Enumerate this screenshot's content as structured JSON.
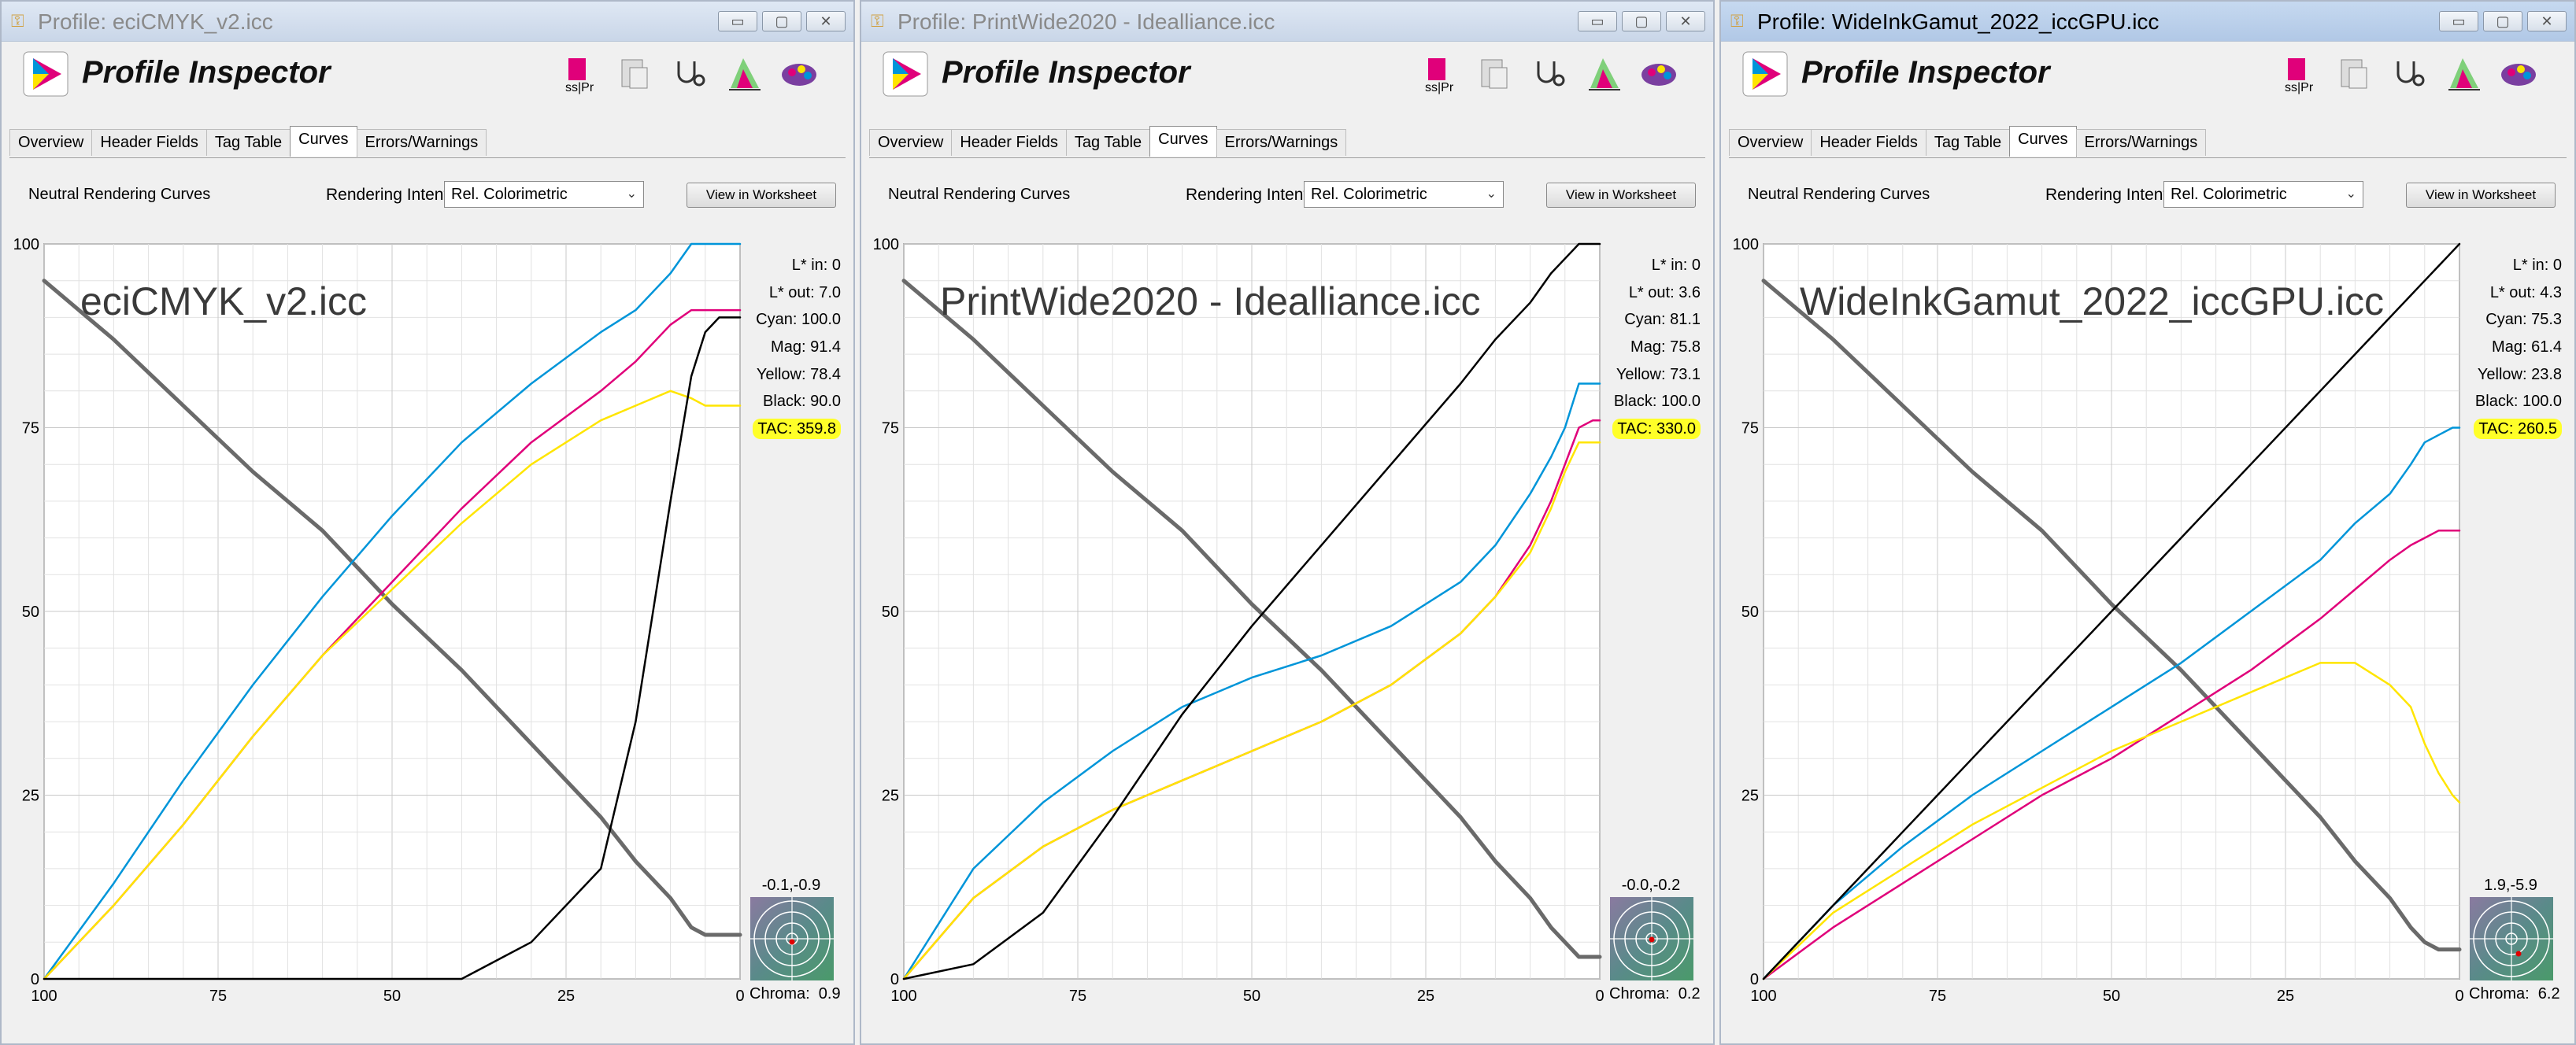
{
  "app_title": "Profile Inspector",
  "tabs": [
    "Overview",
    "Header Fields",
    "Tag Table",
    "Curves",
    "Errors/Warnings"
  ],
  "selected_tab": "Curves",
  "neutral_label": "Neutral Rendering Curves",
  "rendering_intent_label": "Rendering Intent:",
  "rendering_intent_value": "Rel. Colorimetric",
  "view_button": "View in Worksheet",
  "toolbar_icons": [
    "profile-compare-icon",
    "document-icon",
    "stethoscope-icon",
    "gamut-icon",
    "palette-icon"
  ],
  "colors": {
    "cyan": "#0095d9",
    "magenta": "#e0007a",
    "yellow": "#ffe500",
    "black": "#000000",
    "gray": "#6a6a6a",
    "tac_highlight": "#ffff28"
  },
  "axis": {
    "y_ticks": [
      "100",
      "75",
      "50",
      "25",
      "0"
    ],
    "x_ticks": [
      "100",
      "75",
      "50",
      "25",
      "0"
    ]
  },
  "windows": [
    {
      "title": "Profile: eciCMYK_v2.icc",
      "chart_label": "eciCMYK_v2.icc",
      "readout": {
        "l_in": "L* in: 0",
        "l_out": "L* out: 7.0",
        "cyan": "Cyan: 100.0",
        "mag": "Mag: 91.4",
        "yellow": "Yellow: 78.4",
        "black": "Black: 90.0",
        "tac": "TAC: 359.8"
      },
      "bullseye_label": "-0.1,-0.9",
      "chroma": "Chroma:  0.9"
    },
    {
      "title": "Profile: PrintWide2020 - Idealliance.icc",
      "chart_label": "PrintWide2020 - Idealliance.icc",
      "readout": {
        "l_in": "L* in: 0",
        "l_out": "L* out: 3.6",
        "cyan": "Cyan: 81.1",
        "mag": "Mag: 75.8",
        "yellow": "Yellow: 73.1",
        "black": "Black: 100.0",
        "tac": "TAC: 330.0"
      },
      "bullseye_label": "-0.0,-0.2",
      "chroma": "Chroma:  0.2"
    },
    {
      "title": "Profile: WideInkGamut_2022_iccGPU.icc",
      "chart_label": "WideInkGamut_2022_iccGPU.icc",
      "readout": {
        "l_in": "L* in: 0",
        "l_out": "L* out: 4.3",
        "cyan": "Cyan: 75.3",
        "mag": "Mag: 61.4",
        "yellow": "Yellow: 23.8",
        "black": "Black: 100.0",
        "tac": "TAC: 260.5"
      },
      "bullseye_label": "1.9,-5.9",
      "chroma": "Chroma:  6.2"
    }
  ],
  "chart_data": [
    {
      "type": "line",
      "title": "eciCMYK_v2.icc",
      "xlim": [
        100,
        0
      ],
      "ylim": [
        0,
        100
      ],
      "x": [
        100,
        90,
        80,
        70,
        60,
        50,
        40,
        30,
        20,
        15,
        10,
        7,
        5,
        3,
        1,
        0
      ],
      "series": [
        {
          "name": "gray",
          "values": [
            95,
            87,
            78,
            69,
            61,
            51,
            42,
            32,
            22,
            16,
            11,
            7,
            6,
            6,
            6,
            6
          ]
        },
        {
          "name": "cyan",
          "values": [
            0,
            13,
            27,
            40,
            52,
            63,
            73,
            81,
            88,
            91,
            96,
            100,
            100,
            100,
            100,
            100
          ]
        },
        {
          "name": "magenta",
          "values": [
            0,
            10,
            21,
            33,
            44,
            54,
            64,
            73,
            80,
            84,
            89,
            91,
            91,
            91,
            91,
            91
          ]
        },
        {
          "name": "yellow",
          "values": [
            0,
            10,
            21,
            33,
            44,
            53,
            62,
            70,
            76,
            78,
            80,
            79,
            78,
            78,
            78,
            78
          ]
        },
        {
          "name": "black",
          "values": [
            0,
            0,
            0,
            0,
            0,
            0,
            0,
            5,
            15,
            35,
            65,
            82,
            88,
            90,
            90,
            90
          ]
        }
      ]
    },
    {
      "type": "line",
      "title": "PrintWide2020 - Idealliance.icc",
      "xlim": [
        100,
        0
      ],
      "ylim": [
        0,
        100
      ],
      "x": [
        100,
        90,
        80,
        70,
        60,
        50,
        40,
        30,
        20,
        15,
        10,
        7,
        5,
        3,
        1,
        0
      ],
      "series": [
        {
          "name": "gray",
          "values": [
            95,
            87,
            78,
            69,
            61,
            51,
            42,
            32,
            22,
            16,
            11,
            7,
            5,
            3,
            3,
            3
          ]
        },
        {
          "name": "cyan",
          "values": [
            0,
            15,
            24,
            31,
            37,
            41,
            44,
            48,
            54,
            59,
            66,
            71,
            75,
            81,
            81,
            81
          ]
        },
        {
          "name": "magenta",
          "values": [
            0,
            11,
            18,
            23,
            27,
            31,
            35,
            40,
            47,
            52,
            59,
            65,
            70,
            75,
            76,
            76
          ]
        },
        {
          "name": "yellow",
          "values": [
            0,
            11,
            18,
            23,
            27,
            31,
            35,
            40,
            47,
            52,
            58,
            64,
            69,
            73,
            73,
            73
          ]
        },
        {
          "name": "black",
          "values": [
            0,
            2,
            9,
            22,
            36,
            48,
            59,
            70,
            81,
            87,
            92,
            96,
            98,
            100,
            100,
            100
          ]
        }
      ]
    },
    {
      "type": "line",
      "title": "WideInkGamut_2022_iccGPU.icc",
      "xlim": [
        100,
        0
      ],
      "ylim": [
        0,
        100
      ],
      "x": [
        100,
        90,
        80,
        70,
        60,
        50,
        40,
        30,
        20,
        15,
        10,
        7,
        5,
        3,
        1,
        0
      ],
      "series": [
        {
          "name": "gray",
          "values": [
            95,
            87,
            78,
            69,
            61,
            51,
            42,
            32,
            22,
            16,
            11,
            7,
            5,
            4,
            4,
            4
          ]
        },
        {
          "name": "cyan",
          "values": [
            0,
            10,
            18,
            25,
            31,
            37,
            43,
            50,
            57,
            62,
            66,
            70,
            73,
            74,
            75,
            75
          ]
        },
        {
          "name": "magenta",
          "values": [
            0,
            7,
            13,
            19,
            25,
            30,
            36,
            42,
            49,
            53,
            57,
            59,
            60,
            61,
            61,
            61
          ]
        },
        {
          "name": "yellow",
          "values": [
            0,
            9,
            15,
            21,
            26,
            31,
            35,
            39,
            43,
            43,
            40,
            37,
            32,
            28,
            25,
            24
          ]
        },
        {
          "name": "black",
          "values": [
            0,
            10,
            20,
            30,
            40,
            50,
            60,
            70,
            80,
            85,
            90,
            93,
            95,
            97,
            99,
            100
          ]
        }
      ]
    }
  ]
}
